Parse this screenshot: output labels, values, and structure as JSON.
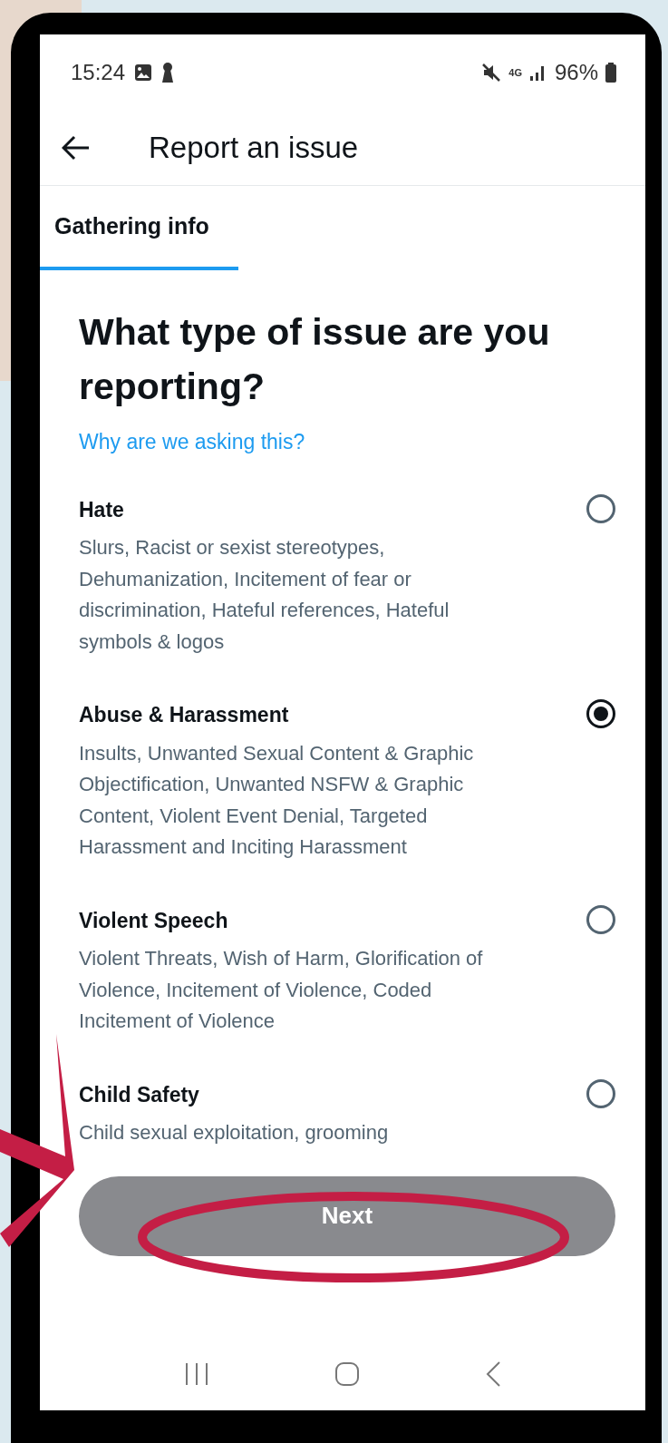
{
  "status_bar": {
    "time": "15:24",
    "network": "4G",
    "battery": "96%"
  },
  "header": {
    "title": "Report an issue"
  },
  "tabs": [
    {
      "label": "Gathering info",
      "selected": true
    }
  ],
  "heading": "What type of issue are you reporting?",
  "help_link": "Why are we asking this?",
  "options": [
    {
      "title": "Hate",
      "description": "Slurs, Racist or sexist stereotypes, Dehumanization, Incitement of fear or discrimination, Hateful references, Hateful symbols & logos",
      "selected": false
    },
    {
      "title": "Abuse & Harassment",
      "description": "Insults, Unwanted Sexual Content & Graphic Objectification, Unwanted NSFW & Graphic Content, Violent Event Denial, Targeted Harassment and Inciting Harassment",
      "selected": true
    },
    {
      "title": "Violent Speech",
      "description": "Violent Threats, Wish of Harm, Glorification of Violence, Incitement of Violence, Coded Incitement of Violence",
      "selected": false
    },
    {
      "title": "Child Safety",
      "description": "Child sexual exploitation, grooming",
      "selected": false
    }
  ],
  "next_button": "Next"
}
